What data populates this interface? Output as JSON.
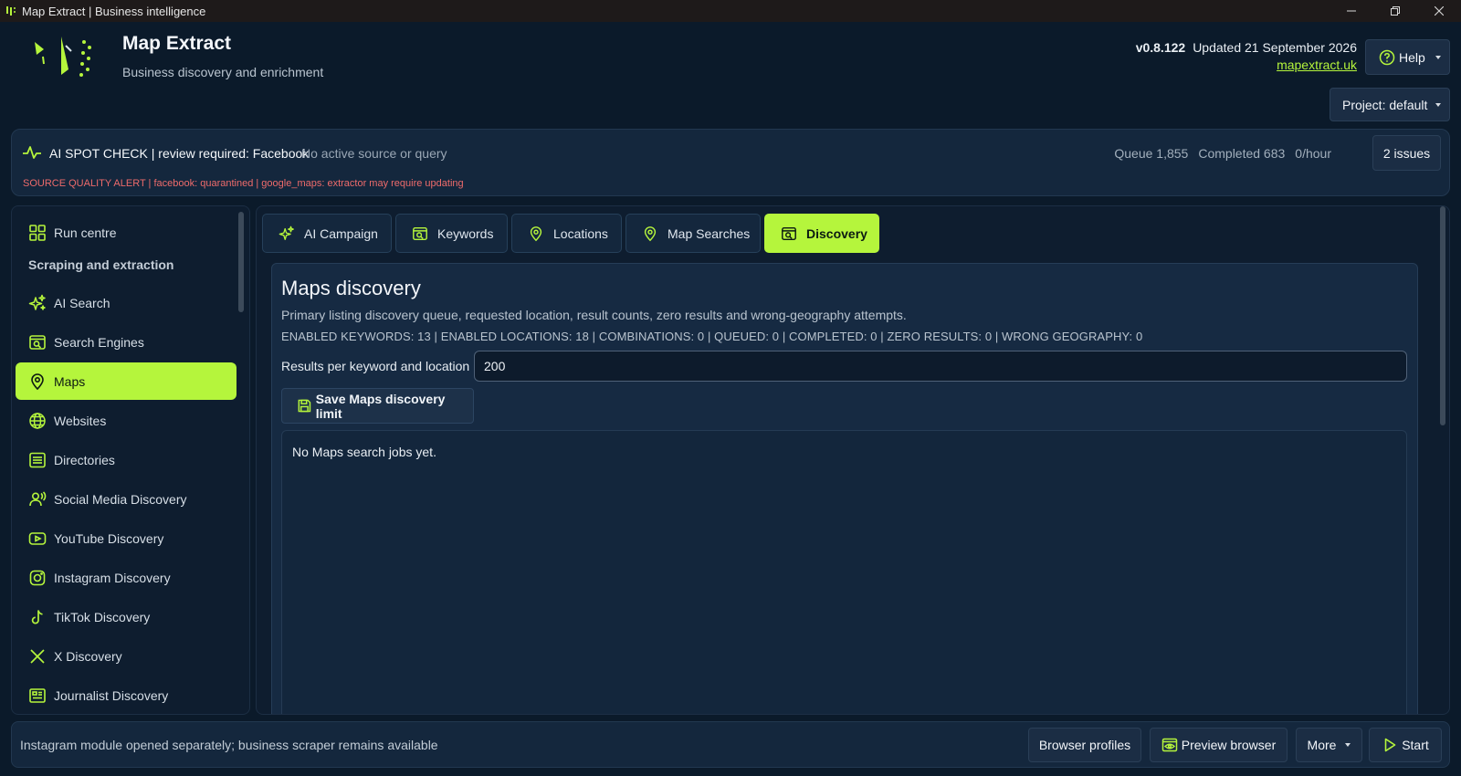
{
  "window": {
    "title": "Map Extract | Business intelligence"
  },
  "header": {
    "app_name": "Map Extract",
    "tagline": "Business discovery and enrichment",
    "version": "v0.8.122",
    "updated": "Updated 21 September 2026",
    "link": "mapextract.uk",
    "help_label": "Help",
    "project_label": "Project: default"
  },
  "alert": {
    "title": "AI SPOT CHECK | review required: Facebook",
    "meta": "No active source or query",
    "warning": "SOURCE QUALITY ALERT | facebook: quarantined | google_maps: extractor may require updating",
    "queue": "Queue 1,855",
    "completed": "Completed 683",
    "rate": "0/hour",
    "issues_label": "2 issues"
  },
  "sidebar": {
    "items": [
      {
        "label": "Run centre",
        "icon": "grid-icon"
      },
      {
        "label": "AI Search",
        "icon": "sparkle-icon"
      },
      {
        "label": "Search Engines",
        "icon": "search-window-icon"
      },
      {
        "label": "Maps",
        "icon": "map-pin-icon",
        "active": true
      },
      {
        "label": "Websites",
        "icon": "globe-icon"
      },
      {
        "label": "Directories",
        "icon": "list-icon"
      },
      {
        "label": "Social Media Discovery",
        "icon": "user-signal-icon"
      },
      {
        "label": "YouTube Discovery",
        "icon": "youtube-icon"
      },
      {
        "label": "Instagram Discovery",
        "icon": "instagram-icon"
      },
      {
        "label": "TikTok Discovery",
        "icon": "tiktok-icon"
      },
      {
        "label": "X Discovery",
        "icon": "x-icon"
      },
      {
        "label": "Journalist Discovery",
        "icon": "newspaper-icon"
      }
    ],
    "section_label": "Scraping and extraction"
  },
  "tabs": [
    {
      "label": "AI Campaign",
      "icon": "sparkle-icon"
    },
    {
      "label": "Keywords",
      "icon": "search-window-icon"
    },
    {
      "label": "Locations",
      "icon": "map-pin-icon"
    },
    {
      "label": "Map Searches",
      "icon": "map-pin-icon"
    },
    {
      "label": "Discovery",
      "icon": "search-window-icon",
      "active": true
    }
  ],
  "panel": {
    "title": "Maps discovery",
    "description": "Primary listing discovery queue, requested location, result counts, zero results and wrong-geography attempts.",
    "counts": "ENABLED KEYWORDS: 13 | ENABLED LOCATIONS: 18 | COMBINATIONS: 0 | QUEUED: 0 | COMPLETED: 0 | ZERO RESULTS: 0 | WRONG GEOGRAPHY: 0",
    "field_label": "Results per keyword and location",
    "field_value": "200",
    "save_label": "Save Maps discovery limit",
    "empty_message": "No Maps search jobs yet."
  },
  "footer": {
    "status": "Instagram module opened separately; business scraper remains available",
    "browser_profiles": "Browser profiles",
    "preview_browser": "Preview browser",
    "more": "More",
    "start": "Start"
  },
  "colors": {
    "accent": "#b5f53c",
    "background": "#0b1a2a",
    "panel": "#162a42",
    "alert_red": "#ee6b6b"
  }
}
